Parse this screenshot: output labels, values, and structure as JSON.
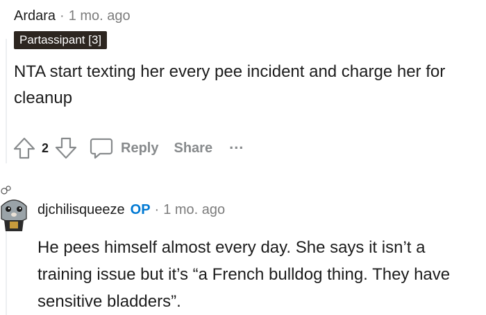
{
  "comment1": {
    "author": "Ardara",
    "separator": "·",
    "time": "1 mo. ago",
    "flair": "Partassipant [3]",
    "body": "NTA start texting her every pee incident and charge her for cleanup",
    "votes": "2",
    "reply_label": "Reply",
    "share_label": "Share",
    "more_label": "..."
  },
  "comment2": {
    "author": "djchilisqueeze",
    "op_badge": "OP",
    "separator": "·",
    "time": "1 mo. ago",
    "body": "He pees himself almost every day. She says it isn’t a training issue but it’s “a French bulldog thing. They have sensitive bladders”."
  },
  "colors": {
    "op": "#0079d3",
    "flair_bg": "#2d2620",
    "muted": "#878a8c"
  }
}
